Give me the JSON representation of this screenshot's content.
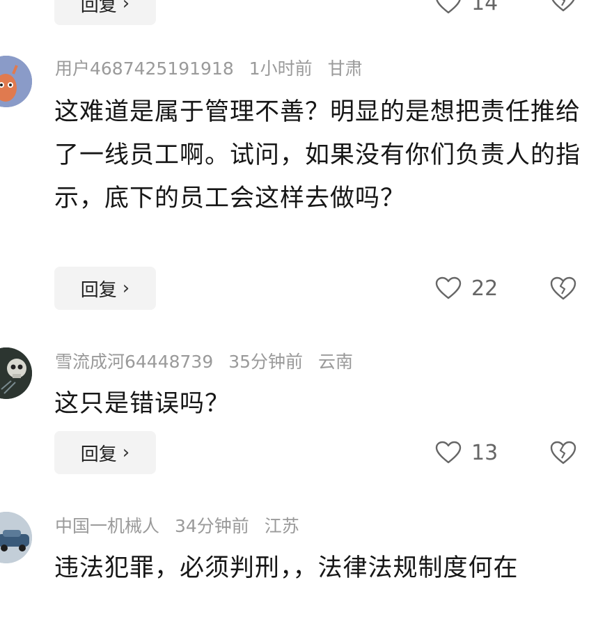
{
  "top_partial": {
    "reply_label": "回复",
    "like_count": "14"
  },
  "comments": [
    {
      "username": "用户4687425191918",
      "time": "1小时前",
      "location": "甘肃",
      "text": "这难道是属于管理不善？明显的是想把责任推给了一线员工啊。试问，如果没有你们负责人的指示，底下的员工会这样去做吗？",
      "reply_label": "回复",
      "like_count": "22"
    },
    {
      "username": "雪流成河64448739",
      "time": "35分钟前",
      "location": "云南",
      "text": "这只是错误吗？",
      "reply_label": "回复",
      "like_count": "13"
    },
    {
      "username": "中国一机械人",
      "time": "34分钟前",
      "location": "江苏",
      "text": "违法犯罪，必须判刑，，法律法规制度何在"
    }
  ],
  "icons": {
    "reply_chevron": "chevron-right-icon",
    "like": "heart-outline-icon",
    "dislike": "broken-heart-icon"
  },
  "colors": {
    "meta_text": "#9a9a9a",
    "reply_bg": "#f3f3f3",
    "icon_stroke": "#666666"
  }
}
